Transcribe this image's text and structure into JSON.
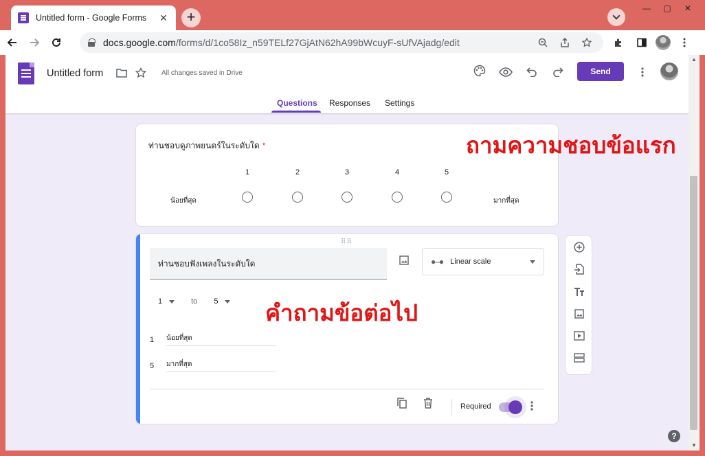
{
  "browser": {
    "tab_title": "Untitled form - Google Forms",
    "tab_close": "✕",
    "new_tab": "+",
    "url_host": "docs.google.com",
    "url_path": "/forms/d/1co58Iz_n59TELf27GjAtN62hA99bWcuyF-sUfVAjadg/edit",
    "win_min": "—",
    "win_max": "▢",
    "win_close": "✕"
  },
  "forms_header": {
    "title": "Untitled form",
    "saved_status": "All changes saved in Drive",
    "send_label": "Send",
    "tabs": [
      {
        "label": "Questions"
      },
      {
        "label": "Responses"
      },
      {
        "label": "Settings"
      }
    ]
  },
  "question1": {
    "title": "ท่านชอบดูภาพยนตร์ในระดับใด",
    "required_mark": "*",
    "scale": [
      "1",
      "2",
      "3",
      "4",
      "5"
    ],
    "low_label": "น้อยที่สุด",
    "high_label": "มากที่สุด",
    "annotation": "ถามความชอบข้อแรก"
  },
  "question2": {
    "title": "ท่านชอบฟังเพลงในระดับใด",
    "type_label": "Linear scale",
    "range_from": "1",
    "range_to_word": "to",
    "range_to": "5",
    "label1_num": "1",
    "label1_text": "น้อยที่สุด",
    "label2_num": "5",
    "label2_text": "มากที่สุด",
    "required_label": "Required",
    "required_on": true,
    "annotation": "คำถามข้อต่อไป"
  },
  "colors": {
    "accent": "#673ab7",
    "active_card": "#4285f4",
    "annotation": "#e21515",
    "background": "#f0ebf8"
  }
}
